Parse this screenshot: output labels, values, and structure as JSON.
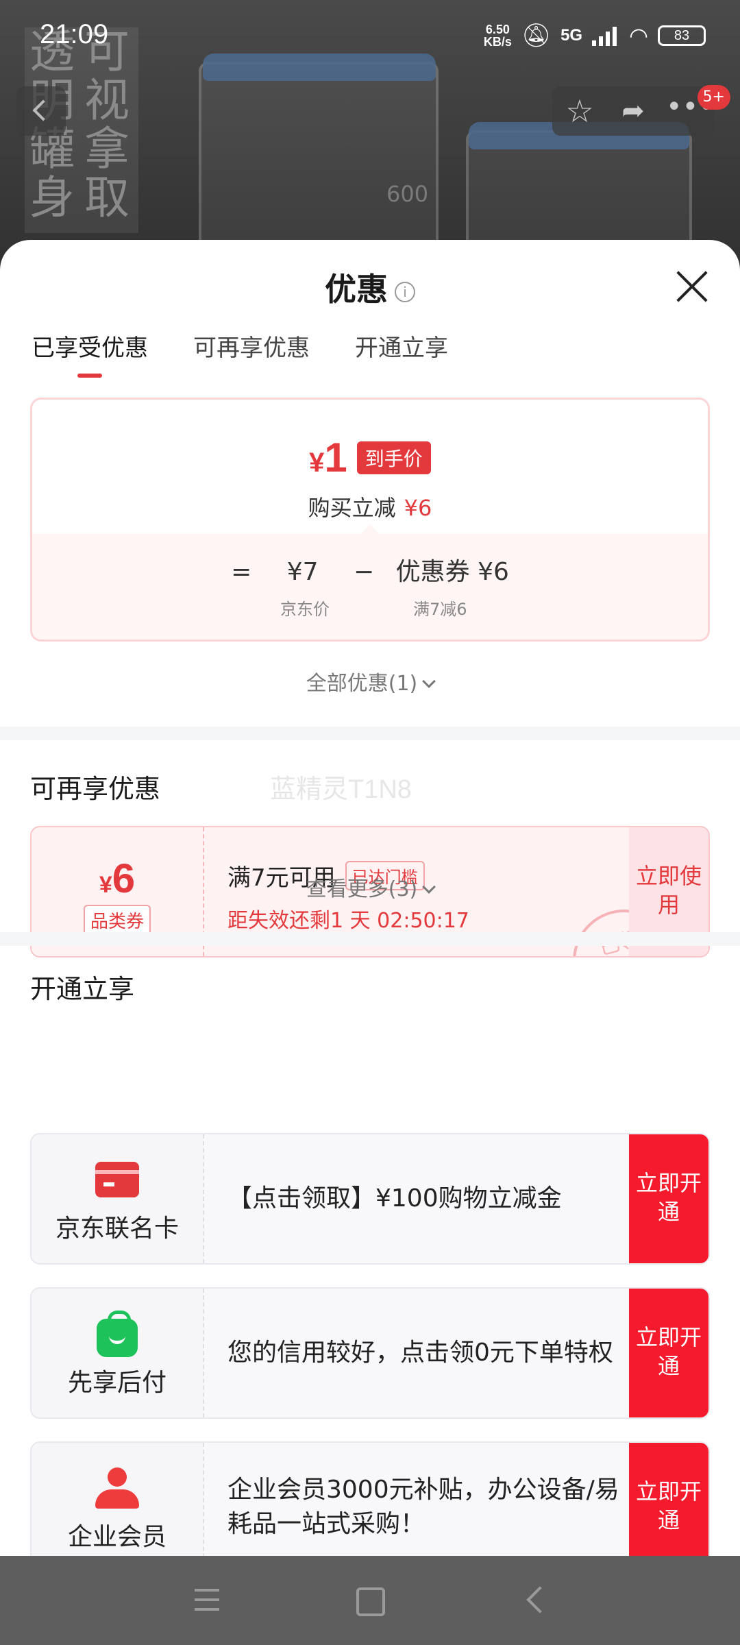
{
  "status_bar": {
    "time": "21:09",
    "net_speed_value": "6.50",
    "net_speed_unit": "KB/s",
    "network": "5G",
    "battery": "83"
  },
  "backdrop": {
    "vertical_text_col1": "透明罐身",
    "vertical_text_col2": "可视拿取",
    "jar_label": "600",
    "notification_badge": "5+"
  },
  "sheet": {
    "title": "优惠",
    "info_icon": "i"
  },
  "tabs": [
    {
      "label": "已享受优惠",
      "active": true
    },
    {
      "label": "可再享优惠",
      "active": false
    },
    {
      "label": "开通立享",
      "active": false
    }
  ],
  "price_card": {
    "currency": "¥",
    "final_price": "1",
    "final_tag": "到手价",
    "reduce_label": "购买立减",
    "reduce_amount": "¥6",
    "equals": "=",
    "base_price": "¥7",
    "minus": "−",
    "coupon_part": "优惠券 ¥6",
    "base_price_label": "京东价",
    "coupon_part_label": "满7减6"
  },
  "all_discounts_link": "全部优惠(1)",
  "section_more": {
    "title": "可再享优惠",
    "watermark": "蓝精灵T1N8",
    "coupon": {
      "currency": "¥",
      "amount": "6",
      "type": "品类券",
      "condition": "满7元可用",
      "threshold_tag": "已达门槛",
      "expire": "距失效还剩1 天 02:50:17",
      "action": "立即使用",
      "stamp": "已领"
    },
    "see_more_link": "查看更多(3)"
  },
  "section_open": {
    "title": "开通立享",
    "offers": [
      {
        "name": "京东联名卡",
        "desc": "【点击领取】¥100购物立减金",
        "action": "立即开通",
        "icon": "credit-card-icon"
      },
      {
        "name": "先享后付",
        "desc": "您的信用较好，点击领0元下单特权",
        "action": "立即开通",
        "icon": "shopping-bag-icon"
      },
      {
        "name": "企业会员",
        "desc": "企业会员3000元补贴，办公设备/易耗品一站式采购！",
        "action": "立即开通",
        "icon": "user-icon"
      }
    ]
  },
  "colors": {
    "accent": "#e4393c",
    "action_red": "#f51a2c",
    "green": "#1ec25a"
  }
}
